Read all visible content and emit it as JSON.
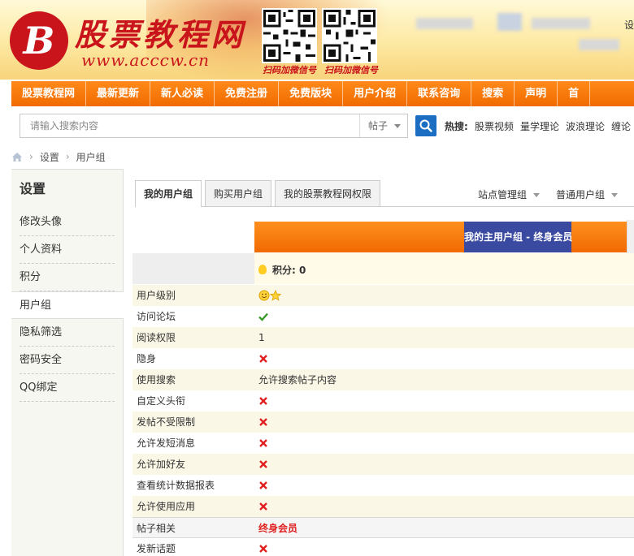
{
  "header": {
    "logo_title": "股票教程网",
    "logo_url": "www.acccw.cn",
    "logo_mark": "B",
    "qr_captions": [
      "扫码加微信号",
      "扫码加微信号"
    ],
    "top_right_partial": "设"
  },
  "nav": {
    "items": [
      "股票教程网",
      "最新更新",
      "新人必读",
      "免费注册",
      "免费版块",
      "用户介绍",
      "联系咨询",
      "搜索",
      "声明",
      "首"
    ]
  },
  "search": {
    "placeholder": "请输入搜索内容",
    "type_label": "帖子",
    "hot_label": "热搜:",
    "hot_links": [
      "股票视频",
      "量学理论",
      "波浪理论",
      "缠论"
    ]
  },
  "breadcrumb": [
    "设置",
    "用户组"
  ],
  "sidebar": {
    "title": "设置",
    "items": [
      "修改头像",
      "个人资料",
      "积分",
      "用户组",
      "隐私筛选",
      "密码安全",
      "QQ绑定"
    ],
    "active_index": 3
  },
  "tabs": {
    "left": [
      "我的用户组",
      "购买用户组",
      "我的股票教程网权限"
    ],
    "right": [
      "站点管理组",
      "普通用户组"
    ]
  },
  "group": {
    "header": "我的主用户组 - 终身会员",
    "credit": "积分: 0"
  },
  "permissions": [
    {
      "label": "用户级别",
      "kind": "stars"
    },
    {
      "label": "访问论坛",
      "kind": "check"
    },
    {
      "label": "阅读权限",
      "kind": "text",
      "value": "1"
    },
    {
      "label": "隐身",
      "kind": "cross"
    },
    {
      "label": "使用搜索",
      "kind": "text",
      "value": "允许搜索帖子内容"
    },
    {
      "label": "自定义头衔",
      "kind": "cross"
    },
    {
      "label": "发帖不受限制",
      "kind": "cross"
    },
    {
      "label": "允许发短消息",
      "kind": "cross"
    },
    {
      "label": "允许加好友",
      "kind": "cross"
    },
    {
      "label": "查看统计数据报表",
      "kind": "cross"
    },
    {
      "label": "允许使用应用",
      "kind": "cross"
    },
    {
      "label": "帖子相关",
      "kind": "section",
      "value": "终身会员"
    },
    {
      "label": "发新话题",
      "kind": "cross"
    }
  ],
  "colors": {
    "nav_orange": "#f06a00",
    "group_blue": "#3a4aa0",
    "brand_red": "#c8141a",
    "cross_red": "#e02020",
    "check_green": "#3a9a2a",
    "search_blue": "#1c6ec2"
  }
}
